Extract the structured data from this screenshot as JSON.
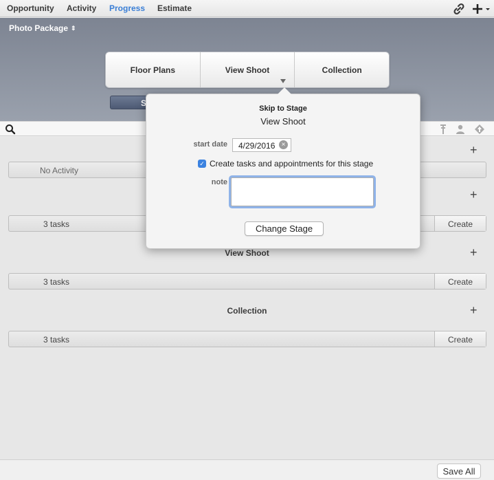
{
  "tabs": [
    {
      "label": "Opportunity",
      "active": false
    },
    {
      "label": "Activity",
      "active": false
    },
    {
      "label": "Progress",
      "active": true
    },
    {
      "label": "Estimate",
      "active": false
    }
  ],
  "toolbar": {
    "link_icon": "link-icon",
    "add_icon": "plus-menu-icon"
  },
  "header": {
    "package_label": "Photo Package",
    "package_arrows": "⇕"
  },
  "stages": [
    "Floor Plans",
    "View Shoot",
    "Collection"
  ],
  "hidden_button_label": "S",
  "popover": {
    "title": "Skip to Stage",
    "subtitle": "View Shoot",
    "start_date_label": "start date",
    "start_date_value": "4/29/2016",
    "checkbox_checked": true,
    "checkbox_label": "Create tasks and appointments for this stage",
    "note_label": "note",
    "note_value": "",
    "change_button": "Change Stage"
  },
  "sections": [
    {
      "title": "",
      "row_label": "No Activity",
      "has_create": false
    },
    {
      "title": "",
      "row_label": "3 tasks",
      "has_create": true,
      "create_label": "Create"
    },
    {
      "title": "View Shoot",
      "row_label": "3 tasks",
      "has_create": true,
      "create_label": "Create"
    },
    {
      "title": "Collection",
      "row_label": "3 tasks",
      "has_create": true,
      "create_label": "Create"
    }
  ],
  "add_symbol": "+",
  "footer": {
    "save_all": "Save All"
  },
  "colors": {
    "accent": "#3b7fd6",
    "header_band": "#8a919e",
    "checkbox": "#3b82e0"
  }
}
